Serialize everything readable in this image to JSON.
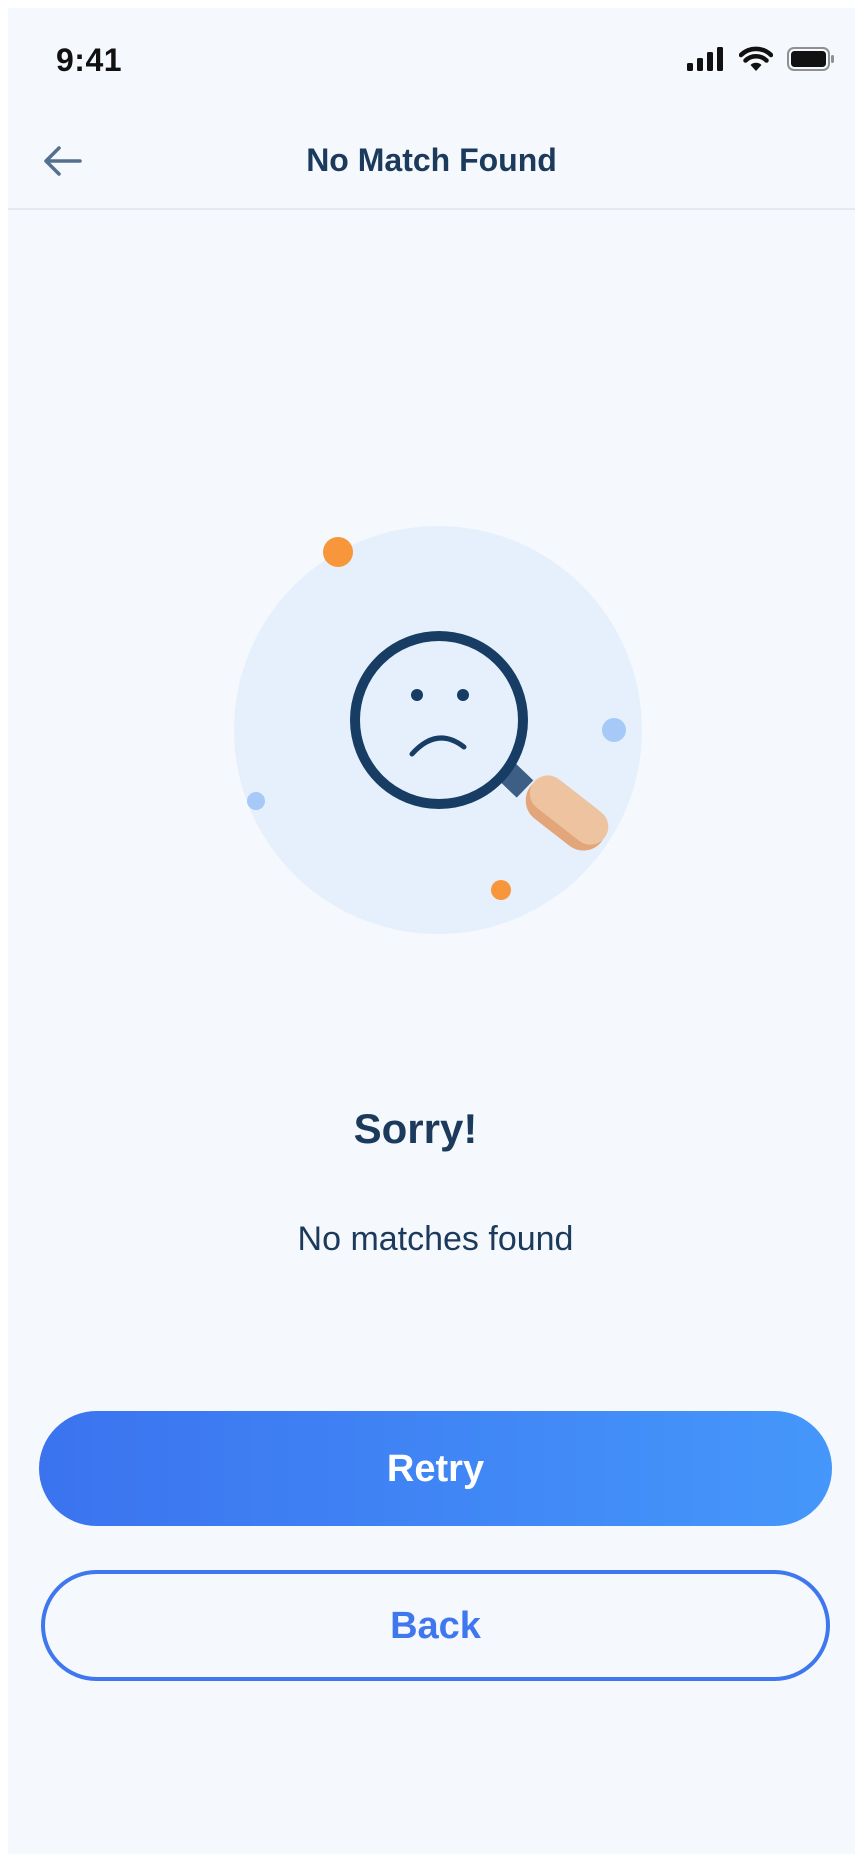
{
  "status_bar": {
    "time": "9:41"
  },
  "nav": {
    "title": "No Match Found",
    "back_icon": "back-arrow-icon"
  },
  "illustration": {
    "icon": "sad-magnifier-icon",
    "colors": {
      "circle_bg": "#e6f0fc",
      "ring": "#173d64",
      "handle": "#e6b892",
      "dot_orange": "#f7963b",
      "dot_blue": "#a7c9f8"
    }
  },
  "message": {
    "title": "Sorry!",
    "subtitle": "No matches found"
  },
  "buttons": {
    "retry_label": "Retry",
    "back_label": "Back"
  },
  "colors": {
    "primary": "#3f77ee",
    "text_dark": "#1b3a5c",
    "background": "#f5f8fc"
  }
}
